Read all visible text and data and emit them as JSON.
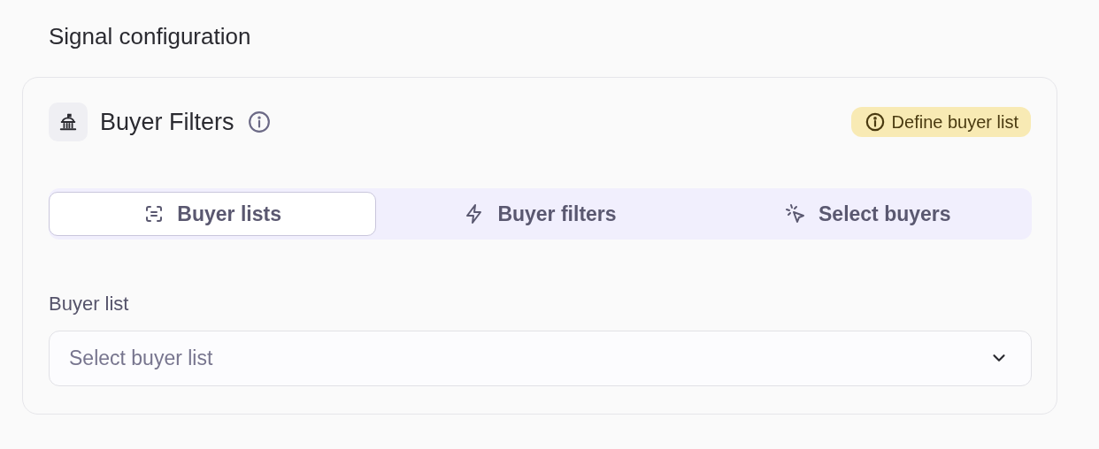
{
  "page_title": "Signal configuration",
  "card": {
    "title": "Buyer Filters",
    "badge": "Define buyer list"
  },
  "tabs": [
    {
      "label": "Buyer lists",
      "kind": "list",
      "selected": true
    },
    {
      "label": "Buyer filters",
      "kind": "bolt",
      "selected": false
    },
    {
      "label": "Select buyers",
      "kind": "click",
      "selected": false
    }
  ],
  "field": {
    "label": "Buyer list",
    "placeholder": "Select buyer list"
  }
}
